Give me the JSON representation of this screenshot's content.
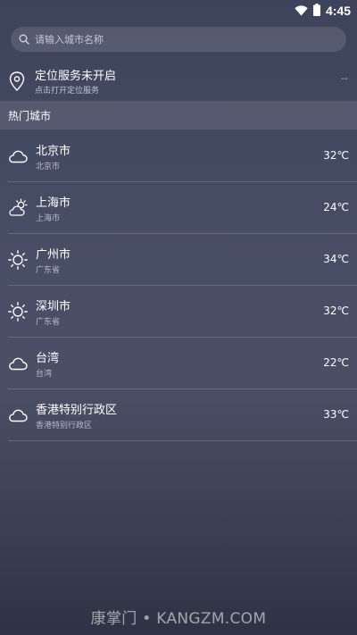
{
  "status_bar": {
    "time": "4:45",
    "icons": [
      "wifi-icon",
      "battery-icon"
    ]
  },
  "search": {
    "placeholder": "请输入城市名称",
    "value": "",
    "icon": "search-icon"
  },
  "location": {
    "title": "定位服务未开启",
    "subtitle": "点击打开定位服务",
    "value": "--",
    "icon": "location-pin-icon"
  },
  "hot_cities": {
    "header": "热门城市",
    "items": [
      {
        "name": "北京市",
        "region": "北京市",
        "temp": "32℃",
        "icon": "cloud-icon"
      },
      {
        "name": "上海市",
        "region": "上海市",
        "temp": "24℃",
        "icon": "partly-cloudy-icon"
      },
      {
        "name": "广州市",
        "region": "广东省",
        "temp": "34℃",
        "icon": "sun-icon"
      },
      {
        "name": "深圳市",
        "region": "广东省",
        "temp": "32℃",
        "icon": "sun-icon"
      },
      {
        "name": "台湾",
        "region": "台湾",
        "temp": "22℃",
        "icon": "cloud-icon"
      },
      {
        "name": "香港特别行政区",
        "region": "香港特别行政区",
        "temp": "33℃",
        "icon": "cloud-icon"
      }
    ]
  },
  "watermark": "康掌门 • KANGZM.COM",
  "colors": {
    "background_top": "#3d435a",
    "background_bottom": "#2f3244",
    "text_primary": "#ffffff",
    "text_secondary": "#b9bccb"
  }
}
